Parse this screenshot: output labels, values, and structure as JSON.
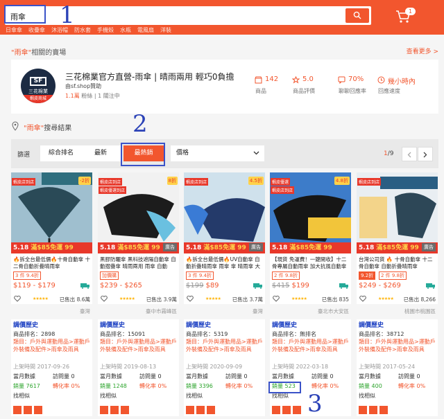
{
  "search": {
    "query": "雨傘",
    "button_icon": "search-icon"
  },
  "quick_links": [
    "日傘傘",
    "收疊傘",
    "沐浴帽",
    "防水套",
    "手機殼",
    "水瓶",
    "電風扇",
    "洋裝"
  ],
  "cart": {
    "count": "1",
    "icon": "cart-icon"
  },
  "annotations": [
    "1",
    "2",
    "3"
  ],
  "shop_section": {
    "keyword": "\"雨傘\"",
    "heading_suffix": "相關的賣場",
    "more_label": "查看更多 >"
  },
  "shop": {
    "name": "三花棉業官方直營-雨傘 | 晴雨兩用 輕巧0負擔",
    "id": "由sf.shop贊助",
    "followers": "1.1萬",
    "followers_label": "粉絲",
    "following": "1 關注中",
    "logo_text": "SF",
    "logo_sub": "三花棉業",
    "logo_badge": "蝦皮商城",
    "stats": [
      {
        "value": "142",
        "label": "商品",
        "icon": "shop-icon"
      },
      {
        "value": "5.0",
        "label": "商品評價",
        "icon": "star-icon"
      },
      {
        "value": "70%",
        "label": "聊聊回應率",
        "icon": "chat-icon"
      },
      {
        "value": "幾小時內",
        "label": "回應速度",
        "icon": "clock-icon"
      }
    ]
  },
  "results": {
    "keyword": "\"雨傘\"",
    "suffix": "搜尋結果"
  },
  "sort": {
    "label": "篩選",
    "options": [
      "綜合排名",
      "最新",
      "最熱銷"
    ],
    "active": "最熱銷",
    "price_label": "價格",
    "page": "1",
    "total": "/9"
  },
  "accent": "#f2562e",
  "products": [
    {
      "title": "🔥拆全台最低價🔥十骨自動傘 十二骨自動折疊晴雨傘",
      "mall": "蝦皮店到店",
      "mall2": "",
      "pct": "-2折",
      "badge_518": "5.18",
      "tag": "3 件 9.4折",
      "price": "$119 - $179",
      "price_old": "",
      "sold": "已售出 8.6萬",
      "loc": "臺灣",
      "ad": false,
      "hist": {
        "title": "調價歷史",
        "rank": "商品排名：2898",
        "cat": "類目：戶外與運動用品>運動戶外裝備及配件>雨傘及雨具",
        "date": "上架時間 2017-09-26",
        "month": "當月數據",
        "visit": "訪問量 0",
        "sales": "銷量 7617",
        "conv": "轉化率 0%",
        "sim": "找相似"
      }
    },
    {
      "title": "黑膠防曬傘 黑科技遮陽自動傘 自動摺疊傘 晴雨兩用 雨傘 自動",
      "mall": "蝦皮店到店",
      "mall2": "蝦皮優選到店",
      "pct": "8折",
      "badge_518": "5.18",
      "tag": "加價購",
      "price": "$239 - $265",
      "price_old": "",
      "sold": "已售出 3.9萬",
      "loc": "臺中市霧峰區",
      "ad": true,
      "hist": {
        "title": "調價歷史",
        "rank": "商品排名：15091",
        "cat": "類目：戶外與運動用品>運動戶外裝備及配件>雨傘及雨具",
        "date": "上架時間 2019-08-13",
        "month": "當月數據",
        "visit": "訪問量 0",
        "sales": "銷量 1248",
        "conv": "轉化率 0%",
        "sim": "找相似"
      }
    },
    {
      "title": "🔥拆全台最低價🔥UV自動傘 自動折疊晴雨傘 雨傘 傘 晴雨傘 大雨",
      "mall": "蝦皮店到店",
      "mall2": "",
      "pct": "4.5折",
      "badge_518": "5.18",
      "tag": "3 件 9.4折",
      "price": "$89",
      "price_old": "$199",
      "sold": "已售出 3.7萬",
      "loc": "臺灣",
      "ad": true,
      "hist": {
        "title": "調價歷史",
        "rank": "商品排名：5319",
        "cat": "類目：戶外與運動用品>運動戶外裝備及配件>雨傘及雨具",
        "date": "上架時間 2020-09-09",
        "month": "當月數據",
        "visit": "訪問量 0",
        "sales": "銷量 3396",
        "conv": "轉化率 0%",
        "sim": "找相似"
      }
    },
    {
      "title": "【現貨 免運費！一鍵開收】十二骨專屬自動雨傘 加大抗風自動傘",
      "mall": "蝦皮優選",
      "mall2": "蝦皮店到店",
      "pct": "4.8折",
      "badge_518": "5.18",
      "tag": "2 件 9.8折",
      "price": "$199",
      "price_old": "$415",
      "sold": "已售出 835",
      "loc": "臺北市大安區",
      "ad": false,
      "hist": {
        "title": "調價歷史",
        "rank": "商品排名：無排名",
        "cat": "類目：戶外與運動用品>運動戶外裝備及配件>雨傘及雨具",
        "date": "上架時間 2022-03-18",
        "month": "當月數據",
        "visit": "訪問量 0",
        "sales": "銷量 523",
        "conv": "轉化率 0%",
        "sim": "找相似"
      }
    },
    {
      "title": "台灣公司貨 🔥 十骨自動傘 十二骨自動傘 自動折疊晴雨傘",
      "mall": "蝦皮店到店",
      "mall2": "",
      "pct": "",
      "badge_518": "5.18",
      "tag": "9.2折",
      "tag2": "2 件 9.8折",
      "price": "$249 - $269",
      "price_old": "",
      "sold": "已售出 8,266",
      "loc": "桃園市桃園區",
      "ad": true,
      "hist": {
        "title": "調價歷史",
        "rank": "商品排名：38712",
        "cat": "類目：戶外與運動用品>運動戶外裝備及配件>雨傘及雨具",
        "date": "上架時間 2017-05-24",
        "month": "當月數據",
        "visit": "訪問量 0",
        "sales": "銷量 400",
        "conv": "轉化率 0%",
        "sim": "找相似"
      }
    }
  ]
}
